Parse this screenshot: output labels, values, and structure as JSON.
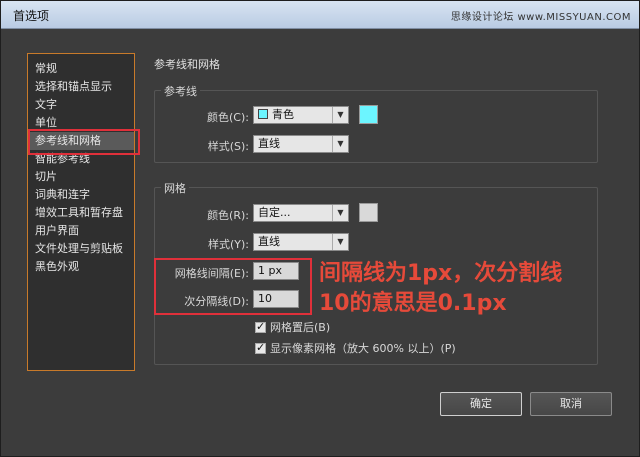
{
  "window": {
    "title": "首选项",
    "watermark": "思缘设计论坛 www.MISSYUAN.COM"
  },
  "sidebar": {
    "items": [
      {
        "label": "常规"
      },
      {
        "label": "选择和锚点显示"
      },
      {
        "label": "文字"
      },
      {
        "label": "单位"
      },
      {
        "label": "参考线和网格"
      },
      {
        "label": "智能参考线"
      },
      {
        "label": "切片"
      },
      {
        "label": "词典和连字"
      },
      {
        "label": "增效工具和暂存盘"
      },
      {
        "label": "用户界面"
      },
      {
        "label": "文件处理与剪贴板"
      },
      {
        "label": "黑色外观"
      }
    ],
    "selected_index": 4
  },
  "main": {
    "section_title": "参考线和网格",
    "guides": {
      "group_label": "参考线",
      "color_label": "颜色(C):",
      "color_value": "青色",
      "color_hex": "#6cf5ff",
      "style_label": "样式(S):",
      "style_value": "直线"
    },
    "grid": {
      "group_label": "网格",
      "color_label": "颜色(R):",
      "color_value": "自定...",
      "swatch_hex": "#d9d9d9",
      "style_label": "样式(Y):",
      "style_value": "直线",
      "gridline_label": "网格线间隔(E):",
      "gridline_value": "1 px",
      "subdiv_label": "次分隔线(D):",
      "subdiv_value": "10",
      "grids_in_back_label": "网格置后(B)",
      "show_pixel_grid_label": "显示像素网格（放大 600% 以上）(P)"
    }
  },
  "annotation": {
    "line1": "间隔线为1px，次分割线",
    "line2": "10的意思是0.1px",
    "color": "#e64a3a"
  },
  "buttons": {
    "ok": "确定",
    "cancel": "取消"
  }
}
